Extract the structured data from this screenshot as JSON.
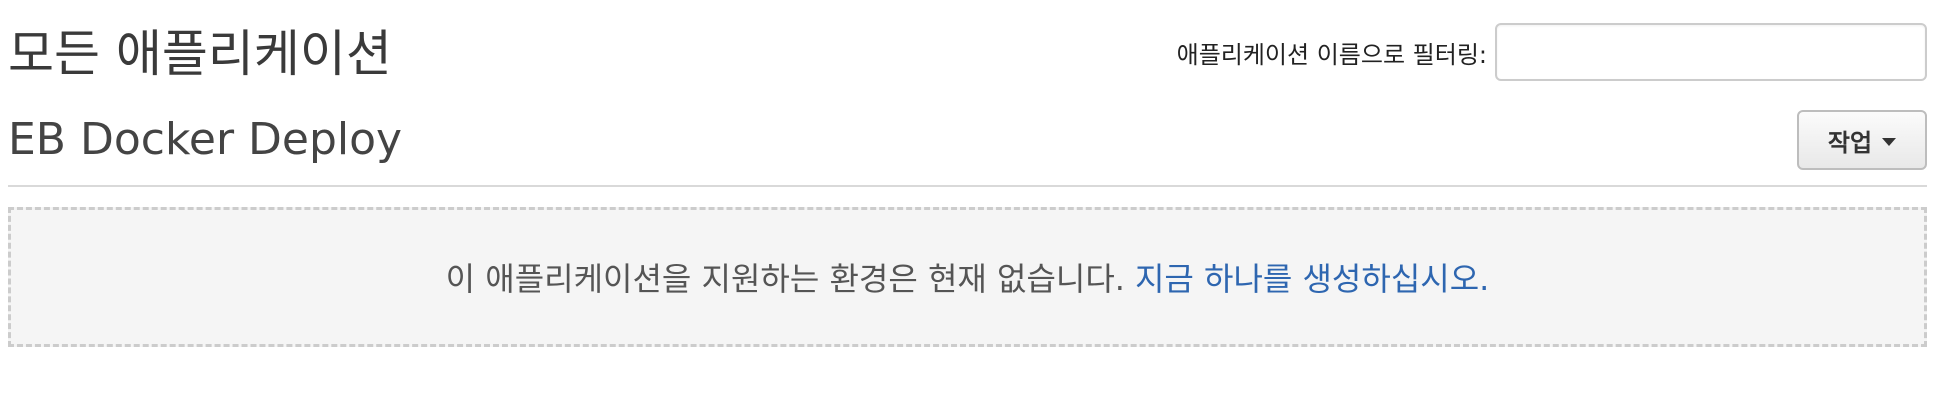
{
  "header": {
    "title": "모든 애플리케이션"
  },
  "filter": {
    "label": "애플리케이션 이름으로 필터링:",
    "value": "",
    "placeholder": ""
  },
  "application": {
    "name": "EB Docker Deploy",
    "actions_label": "작업",
    "actions_icon": "caret-down-icon"
  },
  "environments": {
    "empty_message": "이 애플리케이션을 지원하는 환경은 현재 없습니다.",
    "create_link": "지금 하나를 생성하십시오."
  },
  "colors": {
    "link": "#2e66b0",
    "panel_background": "#f5f5f5",
    "panel_border": "#cccccc",
    "text": "#444444"
  }
}
